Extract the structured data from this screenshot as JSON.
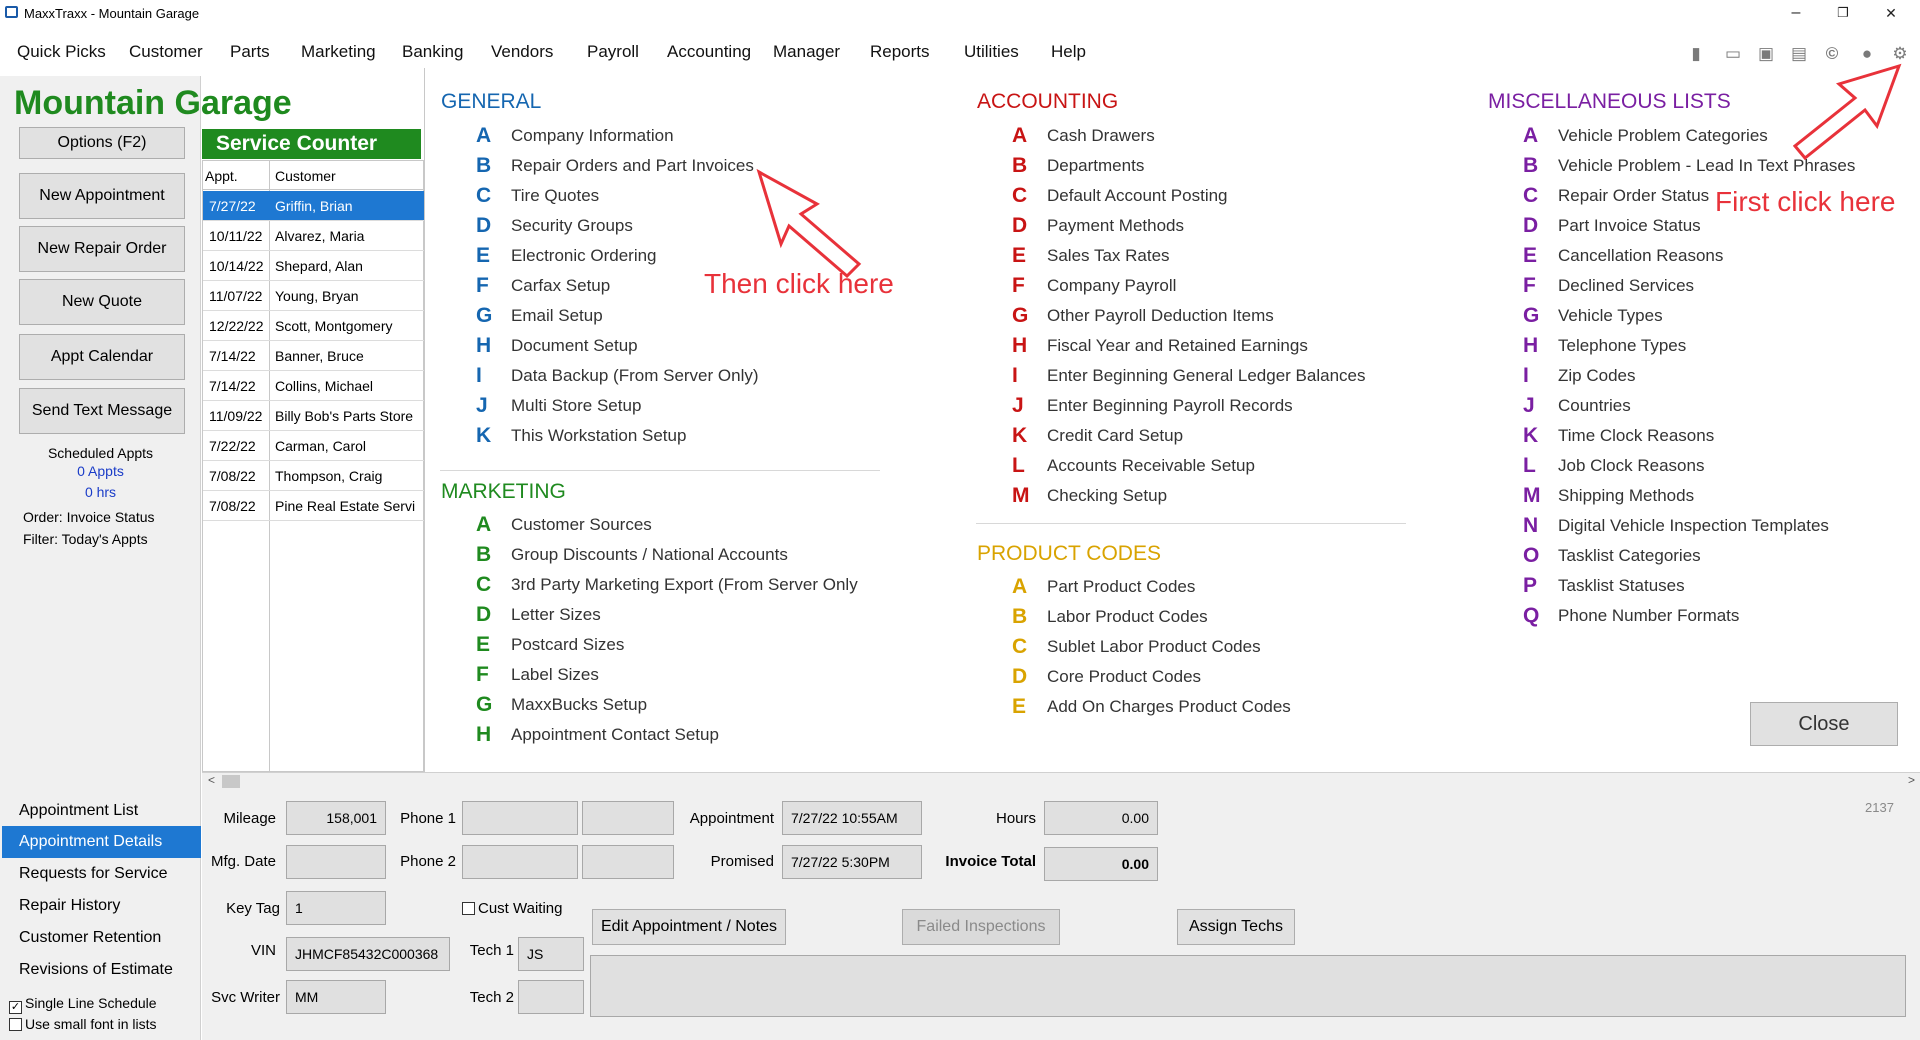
{
  "window": {
    "title": "MaxxTraxx - Mountain Garage",
    "minimize": "–",
    "restore": "❐",
    "close": "✕"
  },
  "menu": [
    "Quick Picks",
    "Customer",
    "Parts",
    "Marketing",
    "Banking",
    "Vendors",
    "Payroll",
    "Accounting",
    "Manager",
    "Reports",
    "Utilities",
    "Help"
  ],
  "toolbar_icons": [
    "book-icon",
    "chat-icon",
    "save-icon",
    "notepad-icon",
    "cm-logo-icon",
    "mechanic-icon",
    "gear-icon"
  ],
  "left": {
    "garage_name": "Mountain Garage",
    "buttons": [
      "Options (F2)",
      "New Appointment",
      "New Repair Order",
      "New Quote",
      "Appt Calendar",
      "Send Text Message"
    ],
    "scheduled_label": "Scheduled Appts",
    "appts_count": "0 Appts",
    "hours": "0 hrs",
    "order_label": "Order: Invoice Status",
    "filter_label": "Filter: Today's Appts",
    "nav": [
      "Appointment List",
      "Appointment Details",
      "Requests for Service",
      "Repair History",
      "Customer Retention",
      "Revisions of Estimate"
    ],
    "active_nav": "Appointment Details",
    "single_line": "Single Line Schedule",
    "small_font": "Use small font in lists",
    "single_line_checked": true,
    "small_font_checked": false
  },
  "service_counter": {
    "title": "Service Counter",
    "col_appt": "Appt.",
    "col_customer": "Customer",
    "rows": [
      {
        "date": "7/27/22",
        "customer": "Griffin, Brian"
      },
      {
        "date": "10/11/22",
        "customer": "Alvarez, Maria"
      },
      {
        "date": "10/14/22",
        "customer": "Shepard, Alan"
      },
      {
        "date": "11/07/22",
        "customer": "Young, Bryan"
      },
      {
        "date": "12/22/22",
        "customer": "Scott, Montgomery"
      },
      {
        "date": "7/14/22",
        "customer": "Banner, Bruce"
      },
      {
        "date": "7/14/22",
        "customer": "Collins, Michael"
      },
      {
        "date": "11/09/22",
        "customer": "Billy Bob's Parts Store"
      },
      {
        "date": "7/22/22",
        "customer": "Carman, Carol"
      },
      {
        "date": "7/08/22",
        "customer": "Thompson, Craig"
      },
      {
        "date": "7/08/22",
        "customer": "Pine Real Estate Servi"
      }
    ]
  },
  "setup": {
    "general": {
      "title": "GENERAL",
      "items": [
        [
          "A",
          "Company Information"
        ],
        [
          "B",
          "Repair Orders and Part Invoices"
        ],
        [
          "C",
          "Tire Quotes"
        ],
        [
          "D",
          "Security Groups"
        ],
        [
          "E",
          "Electronic Ordering"
        ],
        [
          "F",
          "Carfax Setup"
        ],
        [
          "G",
          "Email Setup"
        ],
        [
          "H",
          "Document Setup"
        ],
        [
          "I",
          "Data Backup (From Server Only)"
        ],
        [
          "J",
          "Multi Store Setup"
        ],
        [
          "K",
          "This Workstation Setup"
        ]
      ]
    },
    "marketing": {
      "title": "MARKETING",
      "items": [
        [
          "A",
          "Customer Sources"
        ],
        [
          "B",
          "Group Discounts / National Accounts"
        ],
        [
          "C",
          "3rd Party Marketing Export (From Server Only"
        ],
        [
          "D",
          "Letter Sizes"
        ],
        [
          "E",
          "Postcard Sizes"
        ],
        [
          "F",
          "Label Sizes"
        ],
        [
          "G",
          "MaxxBucks Setup"
        ],
        [
          "H",
          "Appointment Contact Setup"
        ]
      ]
    },
    "accounting": {
      "title": "ACCOUNTING",
      "items": [
        [
          "A",
          "Cash Drawers"
        ],
        [
          "B",
          "Departments"
        ],
        [
          "C",
          "Default Account Posting"
        ],
        [
          "D",
          "Payment Methods"
        ],
        [
          "E",
          "Sales Tax Rates"
        ],
        [
          "F",
          "Company Payroll"
        ],
        [
          "G",
          "Other Payroll Deduction Items"
        ],
        [
          "H",
          "Fiscal Year and Retained Earnings"
        ],
        [
          "I",
          "Enter Beginning General Ledger Balances"
        ],
        [
          "J",
          "Enter Beginning Payroll Records"
        ],
        [
          "K",
          "Credit Card Setup"
        ],
        [
          "L",
          "Accounts Receivable Setup"
        ],
        [
          "M",
          "Checking Setup"
        ]
      ]
    },
    "product_codes": {
      "title": "PRODUCT CODES",
      "items": [
        [
          "A",
          "Part Product Codes"
        ],
        [
          "B",
          "Labor Product Codes"
        ],
        [
          "C",
          "Sublet Labor Product Codes"
        ],
        [
          "D",
          "Core Product Codes"
        ],
        [
          "E",
          "Add On Charges Product Codes"
        ]
      ]
    },
    "misc": {
      "title": "MISCELLANEOUS LISTS",
      "items": [
        [
          "A",
          "Vehicle Problem Categories"
        ],
        [
          "B",
          "Vehicle Problem - Lead In Text Phrases"
        ],
        [
          "C",
          "Repair Order Status"
        ],
        [
          "D",
          "Part Invoice Status"
        ],
        [
          "E",
          "Cancellation Reasons"
        ],
        [
          "F",
          "Declined Services"
        ],
        [
          "G",
          "Vehicle Types"
        ],
        [
          "H",
          "Telephone Types"
        ],
        [
          "I",
          "Zip Codes"
        ],
        [
          "J",
          "Countries"
        ],
        [
          "K",
          "Time Clock Reasons"
        ],
        [
          "L",
          "Job Clock Reasons"
        ],
        [
          "M",
          "Shipping Methods"
        ],
        [
          "N",
          "Digital Vehicle Inspection Templates"
        ],
        [
          "O",
          "Tasklist Categories"
        ],
        [
          "P",
          "Tasklist Statuses"
        ],
        [
          "Q",
          "Phone Number Formats"
        ]
      ]
    },
    "close_label": "Close",
    "colors": {
      "general": "#1566b0",
      "accounting": "#c81414",
      "misc": "#7a1fa2",
      "marketing": "#1f8a1f",
      "product_codes": "#d9a300"
    }
  },
  "annotations": {
    "then_click": "Then click here",
    "first_click": "First click here"
  },
  "details": {
    "record_num": "2137",
    "mileage_label": "Mileage",
    "mileage": "158,001",
    "mfg_label": "Mfg. Date",
    "mfg": "",
    "keytag_label": "Key Tag",
    "keytag": "1",
    "vin_label": "VIN",
    "vin": "JHMCF85432C000368",
    "svc_label": "Svc Writer",
    "svc": "MM",
    "phone1_label": "Phone 1",
    "phone2_label": "Phone 2",
    "cust_waiting": "Cust Waiting",
    "tech1_label": "Tech 1",
    "tech1": "JS",
    "tech2_label": "Tech 2",
    "tech2": "",
    "appointment_label": "Appointment",
    "appointment": "7/27/22 10:55AM",
    "promised_label": "Promised",
    "promised": "7/27/22  5:30PM",
    "hours_label": "Hours",
    "hours": "0.00",
    "invoice_label": "Invoice Total",
    "invoice": "0.00",
    "edit_btn": "Edit Appointment / Notes",
    "failed_btn": "Failed Inspections",
    "assign_btn": "Assign Techs"
  }
}
